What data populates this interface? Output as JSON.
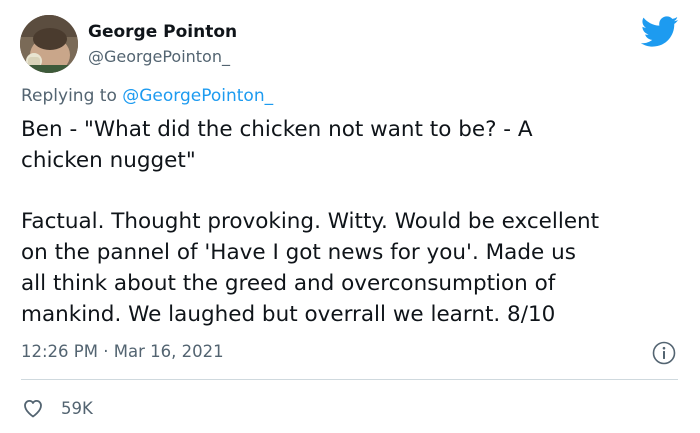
{
  "author": {
    "display_name": "George Pointon",
    "handle": "@GeorgePointon_"
  },
  "reply_context": {
    "prefix": "Replying to ",
    "mention": "@GeorgePointon_"
  },
  "tweet": {
    "lines_paragraph_1": [
      "Ben - \"What did the chicken not want to be? - A",
      "chicken nugget\""
    ],
    "lines_paragraph_2": [
      "Factual. Thought provoking. Witty. Would be excellent",
      "on the pannel of 'Have I got news for you'. Made us",
      "all think about the greed and overconsumption of",
      "mankind. We laughed but overrall we learnt. 8/10"
    ],
    "timestamp": "12:26 PM · Mar 16, 2021"
  },
  "engagement": {
    "likes": "59K"
  },
  "icons": {
    "brand_logo": "twitter-bird-icon",
    "info": "info-icon",
    "like": "heart-icon"
  },
  "colors": {
    "brand": "#1d9bf0",
    "text_primary": "#0f1419",
    "text_secondary": "#536471",
    "divider": "#cfd9de"
  }
}
